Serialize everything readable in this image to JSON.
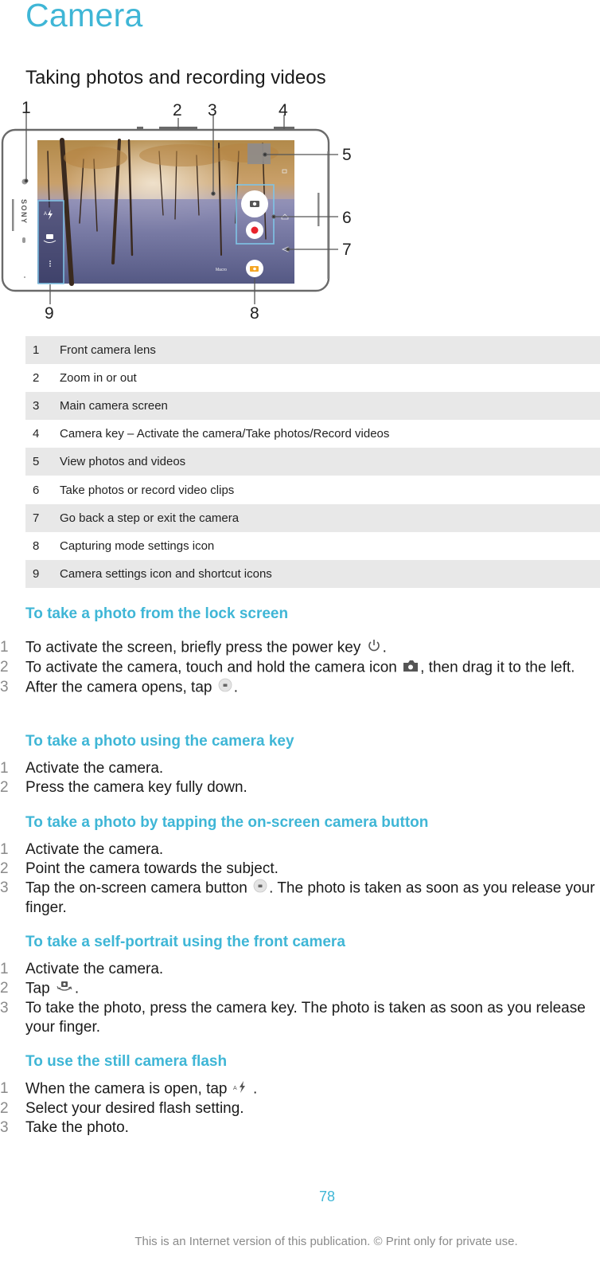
{
  "page": {
    "title": "Camera",
    "section_title": "Taking photos and recording videos"
  },
  "figure": {
    "callouts": [
      "1",
      "2",
      "3",
      "4",
      "5",
      "6",
      "7",
      "8",
      "9"
    ],
    "brand": "SONY",
    "macro_label": "Macro",
    "accent_color": "#3fb6d6",
    "record_color": "#e8232c",
    "mode_color": "#f5a623"
  },
  "legend": [
    {
      "num": "1",
      "text": "Front camera lens"
    },
    {
      "num": "2",
      "text": "Zoom in or out"
    },
    {
      "num": "3",
      "text": "Main camera screen"
    },
    {
      "num": "4",
      "text": "Camera key – Activate the camera/Take photos/Record videos"
    },
    {
      "num": "5",
      "text": "View photos and videos"
    },
    {
      "num": "6",
      "text": "Take photos or record video clips"
    },
    {
      "num": "7",
      "text": "Go back a step or exit the camera"
    },
    {
      "num": "8",
      "text": "Capturing mode settings icon"
    },
    {
      "num": "9",
      "text": "Camera settings icon and shortcut icons"
    }
  ],
  "procedures": [
    {
      "title": "To take a photo from the lock screen",
      "steps": [
        {
          "num": "1",
          "before": "To activate the screen, briefly press the power key ",
          "icon": "power-icon",
          "after": "."
        },
        {
          "num": "2",
          "before": "To activate the camera, touch and hold the camera icon ",
          "icon": "camera-lock-icon",
          "after": ", then drag it to the left."
        },
        {
          "num": "3",
          "before": "After the camera opens, tap ",
          "icon": "shutter-icon",
          "after": "."
        }
      ]
    },
    {
      "title": "To take a photo using the camera key",
      "steps": [
        {
          "num": "1",
          "text": "Activate the camera."
        },
        {
          "num": "2",
          "text": "Press the camera key fully down."
        }
      ]
    },
    {
      "title": "To take a photo by tapping the on-screen camera button",
      "steps": [
        {
          "num": "1",
          "text": "Activate the camera."
        },
        {
          "num": "2",
          "text": "Point the camera towards the subject."
        },
        {
          "num": "3",
          "before": "Tap the on-screen camera button ",
          "icon": "shutter-icon",
          "after": ". The photo is taken as soon as you release your finger."
        }
      ]
    },
    {
      "title": "To take a self-portrait using the front camera",
      "steps": [
        {
          "num": "1",
          "text": "Activate the camera."
        },
        {
          "num": "2",
          "before": "Tap ",
          "icon": "switch-camera-icon",
          "after": "."
        },
        {
          "num": "3",
          "text": "To take the photo, press the camera key. The photo is taken as soon as you release your finger."
        }
      ]
    },
    {
      "title": "To use the still camera flash",
      "steps": [
        {
          "num": "1",
          "before": "When the camera is open, tap ",
          "icon": "auto-flash-icon",
          "after": " ."
        },
        {
          "num": "2",
          "text": "Select your desired flash setting."
        },
        {
          "num": "3",
          "text": "Take the photo."
        }
      ]
    }
  ],
  "footer": {
    "page_number": "78",
    "note": "This is an Internet version of this publication. © Print only for private use."
  }
}
